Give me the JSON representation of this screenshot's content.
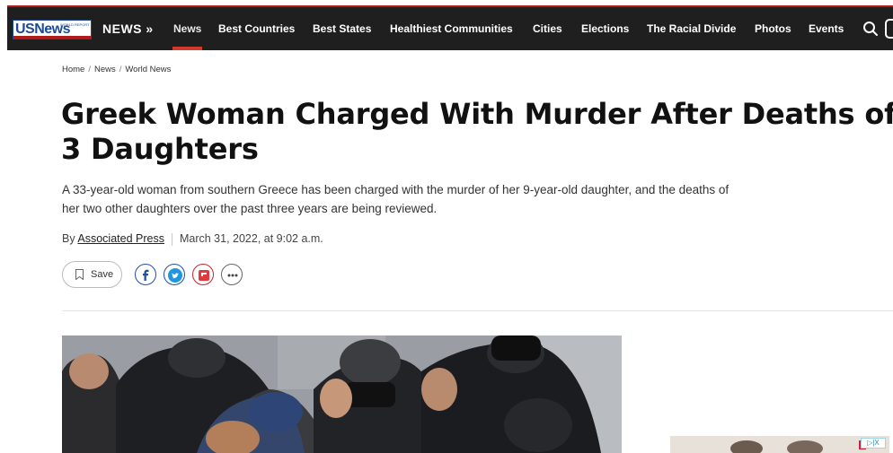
{
  "header": {
    "logo_text": "USNews",
    "logo_subtext": "WORLD REPORT",
    "section_label": "NEWS »",
    "nav": [
      "News",
      "Best Countries",
      "Best States",
      "Healthiest Communities",
      "Cities",
      "Elections",
      "The Racial Divide",
      "Photos",
      "Events"
    ],
    "active_nav": "News",
    "colors": {
      "bar": "#1f1f1f",
      "accent": "#d23a2b",
      "logo_blue": "#1d4a97"
    }
  },
  "breadcrumb": [
    "Home",
    "News",
    "World News"
  ],
  "article": {
    "headline_line1": "Greek Woman Charged With Murder After Deaths of",
    "headline_line2": "3 Daughters",
    "dek_line1": "A 33-year-old woman from southern Greece has been charged with the murder of her 9-year-old daughter, and the deaths of",
    "dek_line2": "her two other daughters over the past three years are being reviewed.",
    "byline_prefix": "By",
    "author": "Associated Press",
    "timestamp": "March 31, 2022, at 9:02 a.m."
  },
  "actions": {
    "save_label": "Save",
    "share_icons": [
      "facebook-icon",
      "twitter-icon",
      "flipboard-icon",
      "more-icon"
    ]
  },
  "ad": {
    "badge": "▷|X"
  }
}
